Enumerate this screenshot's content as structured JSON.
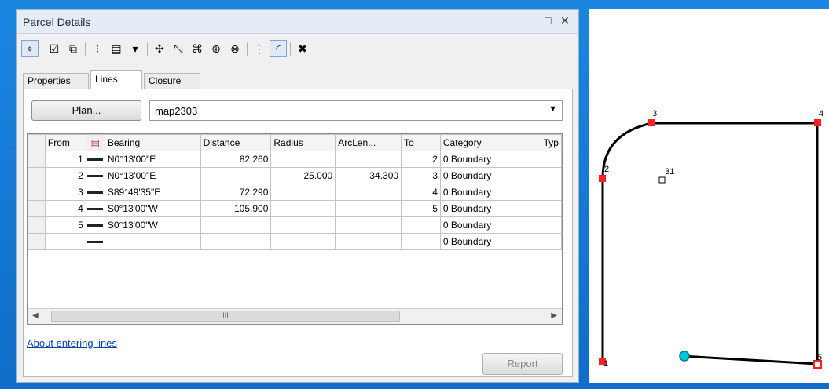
{
  "window": {
    "title": "Parcel Details",
    "maximize_glyph": "□",
    "close_glyph": "✕"
  },
  "toolbar": {
    "tools": [
      {
        "icon": "crosshair-icon",
        "glyph": "⌖",
        "active": true
      },
      {
        "icon": "check-icon",
        "glyph": "☑"
      },
      {
        "icon": "copy-icon",
        "glyph": "⧉"
      },
      {
        "icon": "points-grid-icon",
        "glyph": "⁝"
      },
      {
        "icon": "pages-icon",
        "glyph": "▤"
      },
      {
        "icon": "dropdown-arrow-icon",
        "glyph": "▾"
      },
      {
        "icon": "join-icon",
        "glyph": "✣"
      },
      {
        "icon": "line-tool-icon",
        "glyph": "⤡"
      },
      {
        "icon": "point-tool-icon",
        "glyph": "⌘"
      },
      {
        "icon": "circle-tool-icon",
        "glyph": "⊕"
      },
      {
        "icon": "circle-edit-icon",
        "glyph": "⊗"
      },
      {
        "icon": "sequence-icon",
        "glyph": "⋮"
      },
      {
        "icon": "curve-icon",
        "glyph": "◜",
        "active": true
      },
      {
        "icon": "delete-icon",
        "glyph": "✖"
      }
    ]
  },
  "tabs": [
    {
      "label": "Properties"
    },
    {
      "label": "Lines",
      "selected": true
    },
    {
      "label": "Closure"
    }
  ],
  "plan": {
    "button_label": "Plan...",
    "selected": "map2303"
  },
  "grid": {
    "columns": [
      "From",
      "Bearing",
      "Distance",
      "Radius",
      "ArcLen...",
      "To",
      "Category",
      "Typ"
    ],
    "rows": [
      {
        "from": "1",
        "bearing": "N0°13'00\"E",
        "distance": "82.260",
        "radius": "",
        "arclen": "",
        "to": "2",
        "category": "0 Boundary"
      },
      {
        "from": "2",
        "bearing": "N0°13'00\"E",
        "distance": "",
        "radius": "25.000",
        "arclen": "34.300",
        "to": "3",
        "category": "0 Boundary"
      },
      {
        "from": "3",
        "bearing": "S89°49'35\"E",
        "distance": "72.290",
        "radius": "",
        "arclen": "",
        "to": "4",
        "category": "0 Boundary"
      },
      {
        "from": "4",
        "bearing": "S0°13'00\"W",
        "distance": "105.900",
        "radius": "",
        "arclen": "",
        "to": "5",
        "category": "0 Boundary"
      },
      {
        "from": "5",
        "bearing": "S0°13'00\"W",
        "distance": "",
        "radius": "",
        "arclen": "",
        "to": "",
        "category": "0 Boundary"
      },
      {
        "from": "",
        "bearing": "",
        "distance": "",
        "radius": "",
        "arclen": "",
        "to": "",
        "category": "0 Boundary"
      }
    ],
    "scroll_thumb_glyph": "III"
  },
  "links": {
    "about": "About entering lines"
  },
  "buttons": {
    "report": "Report"
  },
  "map": {
    "point_labels": [
      "1",
      "2",
      "3",
      "4",
      "5",
      "31"
    ],
    "colors": {
      "line": "#000000",
      "vertex": "#ff0000",
      "start_point": "#00c8d8"
    }
  }
}
